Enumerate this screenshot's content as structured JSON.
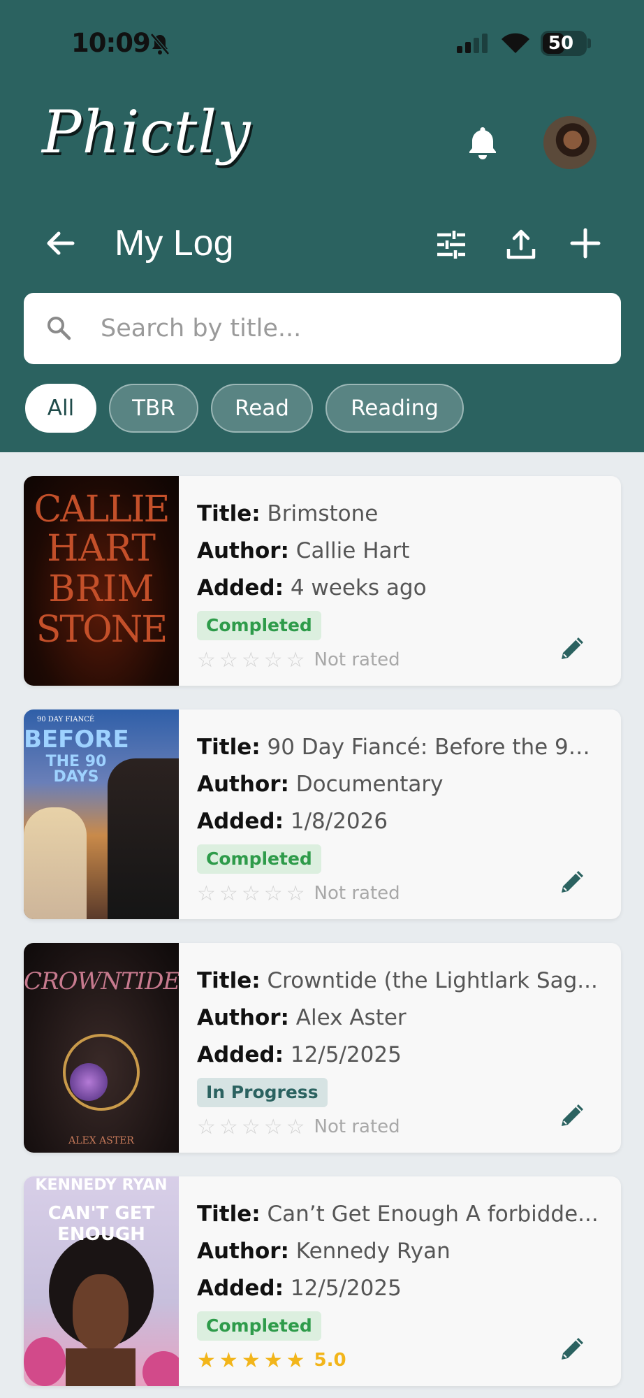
{
  "status_bar": {
    "time": "10:09",
    "battery": "50"
  },
  "app": {
    "logo": "Phictly"
  },
  "toolbar": {
    "title": "My Log"
  },
  "search": {
    "placeholder": "Search by title..."
  },
  "filters": [
    {
      "label": "All",
      "active": true
    },
    {
      "label": "TBR",
      "active": false
    },
    {
      "label": "Read",
      "active": false
    },
    {
      "label": "Reading",
      "active": false
    }
  ],
  "labels": {
    "title": "Title:",
    "author": "Author:",
    "added": "Added:"
  },
  "entries": [
    {
      "title": "Brimstone",
      "author": "Callie Hart",
      "added": "4 weeks ago",
      "status": "Completed",
      "rating_text": "Not rated",
      "stars": 0,
      "cover_lines": [
        "CALLIE",
        "HART",
        "BRIM",
        "STONE"
      ]
    },
    {
      "title": "90 Day Fiancé: Before the 90 ...",
      "author": "Documentary",
      "added": "1/8/2026",
      "status": "Completed",
      "rating_text": "Not rated",
      "stars": 0,
      "cover_lines": [
        "90 DAY FIANCÉ",
        "BEFORE",
        "THE 90 DAYS"
      ]
    },
    {
      "title": "Crowntide (the Lightlark Sag...",
      "author": "Alex Aster",
      "added": "12/5/2025",
      "status": "In Progress",
      "rating_text": "Not rated",
      "stars": 0,
      "cover_lines": [
        "CROWNTIDE",
        "ALEX ASTER"
      ]
    },
    {
      "title": "Can’t Get Enough A forbidde...",
      "author": "Kennedy Ryan",
      "added": "12/5/2025",
      "status": "Completed",
      "rating_text": "5.0",
      "stars": 5,
      "cover_lines": [
        "KENNEDY RYAN",
        "CAN'T GET",
        "ENOUGH"
      ]
    }
  ]
}
